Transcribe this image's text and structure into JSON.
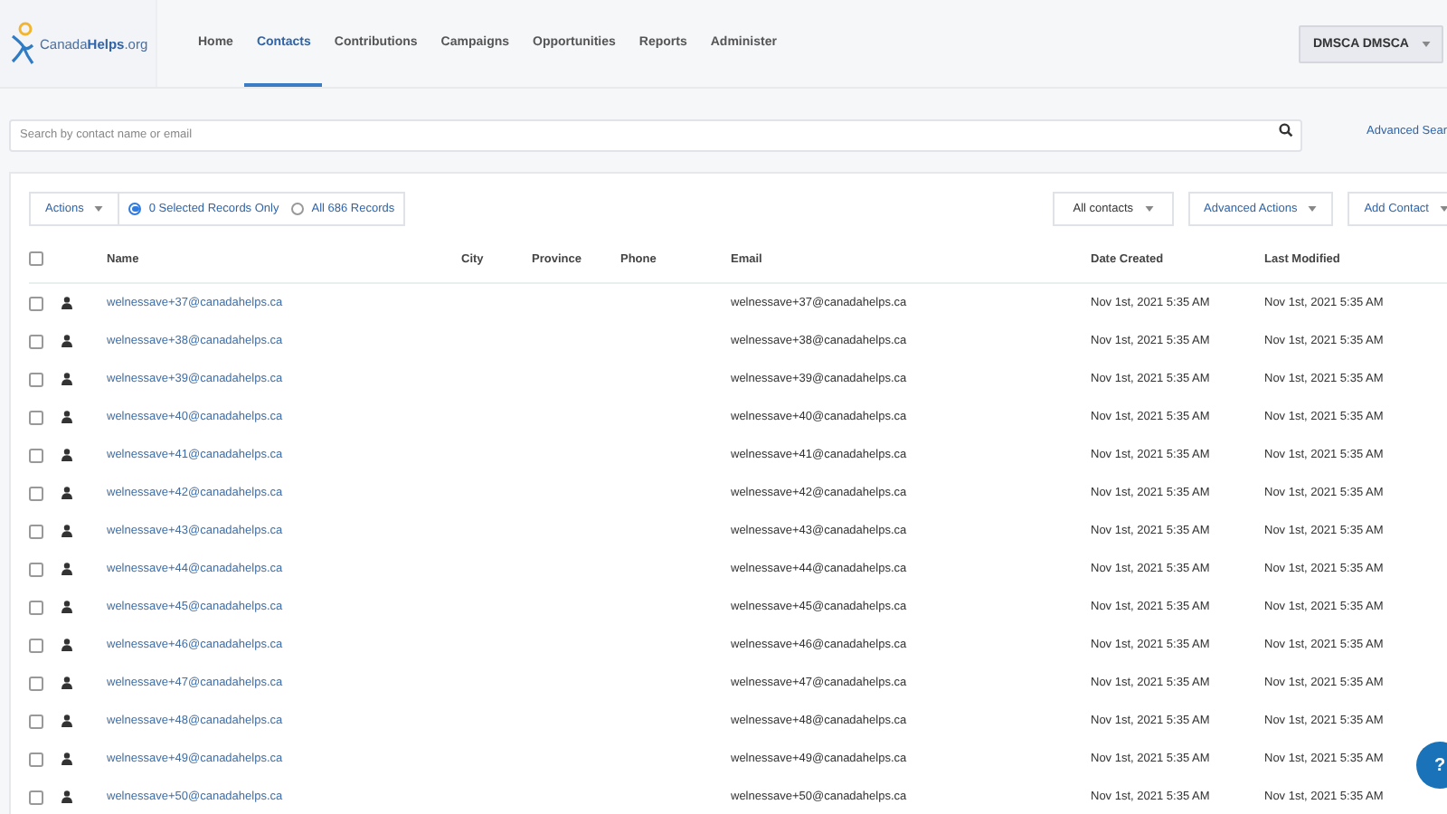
{
  "header": {
    "logo": {
      "text_plain": "Canada",
      "text_bold": "Helps",
      "text_suffix": ".org"
    },
    "nav": [
      {
        "label": "Home",
        "selected": false
      },
      {
        "label": "Contacts",
        "selected": true
      },
      {
        "label": "Contributions",
        "selected": false
      },
      {
        "label": "Campaigns",
        "selected": false
      },
      {
        "label": "Opportunities",
        "selected": false
      },
      {
        "label": "Reports",
        "selected": false
      },
      {
        "label": "Administer",
        "selected": false
      }
    ],
    "user_menu": "DMSCA DMSCA"
  },
  "search": {
    "placeholder": "Search by contact name or email",
    "advanced_link": "Advanced Sear"
  },
  "toolbar": {
    "actions": "Actions",
    "scope": [
      {
        "label": "0 Selected Records Only",
        "selected": true
      },
      {
        "label": "All 686 Records",
        "selected": false
      }
    ],
    "filter": "All contacts",
    "advanced_actions": "Advanced Actions",
    "add_contact": "Add Contact"
  },
  "table": {
    "select_all_checked": false,
    "columns": [
      "Name",
      "City",
      "Province",
      "Phone",
      "Email",
      "Date Created",
      "Last Modified"
    ],
    "rows": [
      {
        "checked": false,
        "name": "welnessave+37@canadahelps.ca",
        "email": "welnessave+37@canadahelps.ca",
        "created": "Nov 1st, 2021 5:35 AM",
        "modified": "Nov 1st, 2021 5:35 AM"
      },
      {
        "checked": false,
        "name": "welnessave+38@canadahelps.ca",
        "email": "welnessave+38@canadahelps.ca",
        "created": "Nov 1st, 2021 5:35 AM",
        "modified": "Nov 1st, 2021 5:35 AM"
      },
      {
        "checked": false,
        "name": "welnessave+39@canadahelps.ca",
        "email": "welnessave+39@canadahelps.ca",
        "created": "Nov 1st, 2021 5:35 AM",
        "modified": "Nov 1st, 2021 5:35 AM"
      },
      {
        "checked": false,
        "name": "welnessave+40@canadahelps.ca",
        "email": "welnessave+40@canadahelps.ca",
        "created": "Nov 1st, 2021 5:35 AM",
        "modified": "Nov 1st, 2021 5:35 AM"
      },
      {
        "checked": false,
        "name": "welnessave+41@canadahelps.ca",
        "email": "welnessave+41@canadahelps.ca",
        "created": "Nov 1st, 2021 5:35 AM",
        "modified": "Nov 1st, 2021 5:35 AM"
      },
      {
        "checked": false,
        "name": "welnessave+42@canadahelps.ca",
        "email": "welnessave+42@canadahelps.ca",
        "created": "Nov 1st, 2021 5:35 AM",
        "modified": "Nov 1st, 2021 5:35 AM"
      },
      {
        "checked": false,
        "name": "welnessave+43@canadahelps.ca",
        "email": "welnessave+43@canadahelps.ca",
        "created": "Nov 1st, 2021 5:35 AM",
        "modified": "Nov 1st, 2021 5:35 AM"
      },
      {
        "checked": false,
        "name": "welnessave+44@canadahelps.ca",
        "email": "welnessave+44@canadahelps.ca",
        "created": "Nov 1st, 2021 5:35 AM",
        "modified": "Nov 1st, 2021 5:35 AM"
      },
      {
        "checked": false,
        "name": "welnessave+45@canadahelps.ca",
        "email": "welnessave+45@canadahelps.ca",
        "created": "Nov 1st, 2021 5:35 AM",
        "modified": "Nov 1st, 2021 5:35 AM"
      },
      {
        "checked": false,
        "name": "welnessave+46@canadahelps.ca",
        "email": "welnessave+46@canadahelps.ca",
        "created": "Nov 1st, 2021 5:35 AM",
        "modified": "Nov 1st, 2021 5:35 AM"
      },
      {
        "checked": false,
        "name": "welnessave+47@canadahelps.ca",
        "email": "welnessave+47@canadahelps.ca",
        "created": "Nov 1st, 2021 5:35 AM",
        "modified": "Nov 1st, 2021 5:35 AM"
      },
      {
        "checked": false,
        "name": "welnessave+48@canadahelps.ca",
        "email": "welnessave+48@canadahelps.ca",
        "created": "Nov 1st, 2021 5:35 AM",
        "modified": "Nov 1st, 2021 5:35 AM"
      },
      {
        "checked": false,
        "name": "welnessave+49@canadahelps.ca",
        "email": "welnessave+49@canadahelps.ca",
        "created": "Nov 1st, 2021 5:35 AM",
        "modified": "Nov 1st, 2021 5:35 AM"
      },
      {
        "checked": false,
        "name": "welnessave+50@canadahelps.ca",
        "email": "welnessave+50@canadahelps.ca",
        "created": "Nov 1st, 2021 5:35 AM",
        "modified": "Nov 1st, 2021 5:35 AM"
      }
    ]
  },
  "help_button": "?"
}
